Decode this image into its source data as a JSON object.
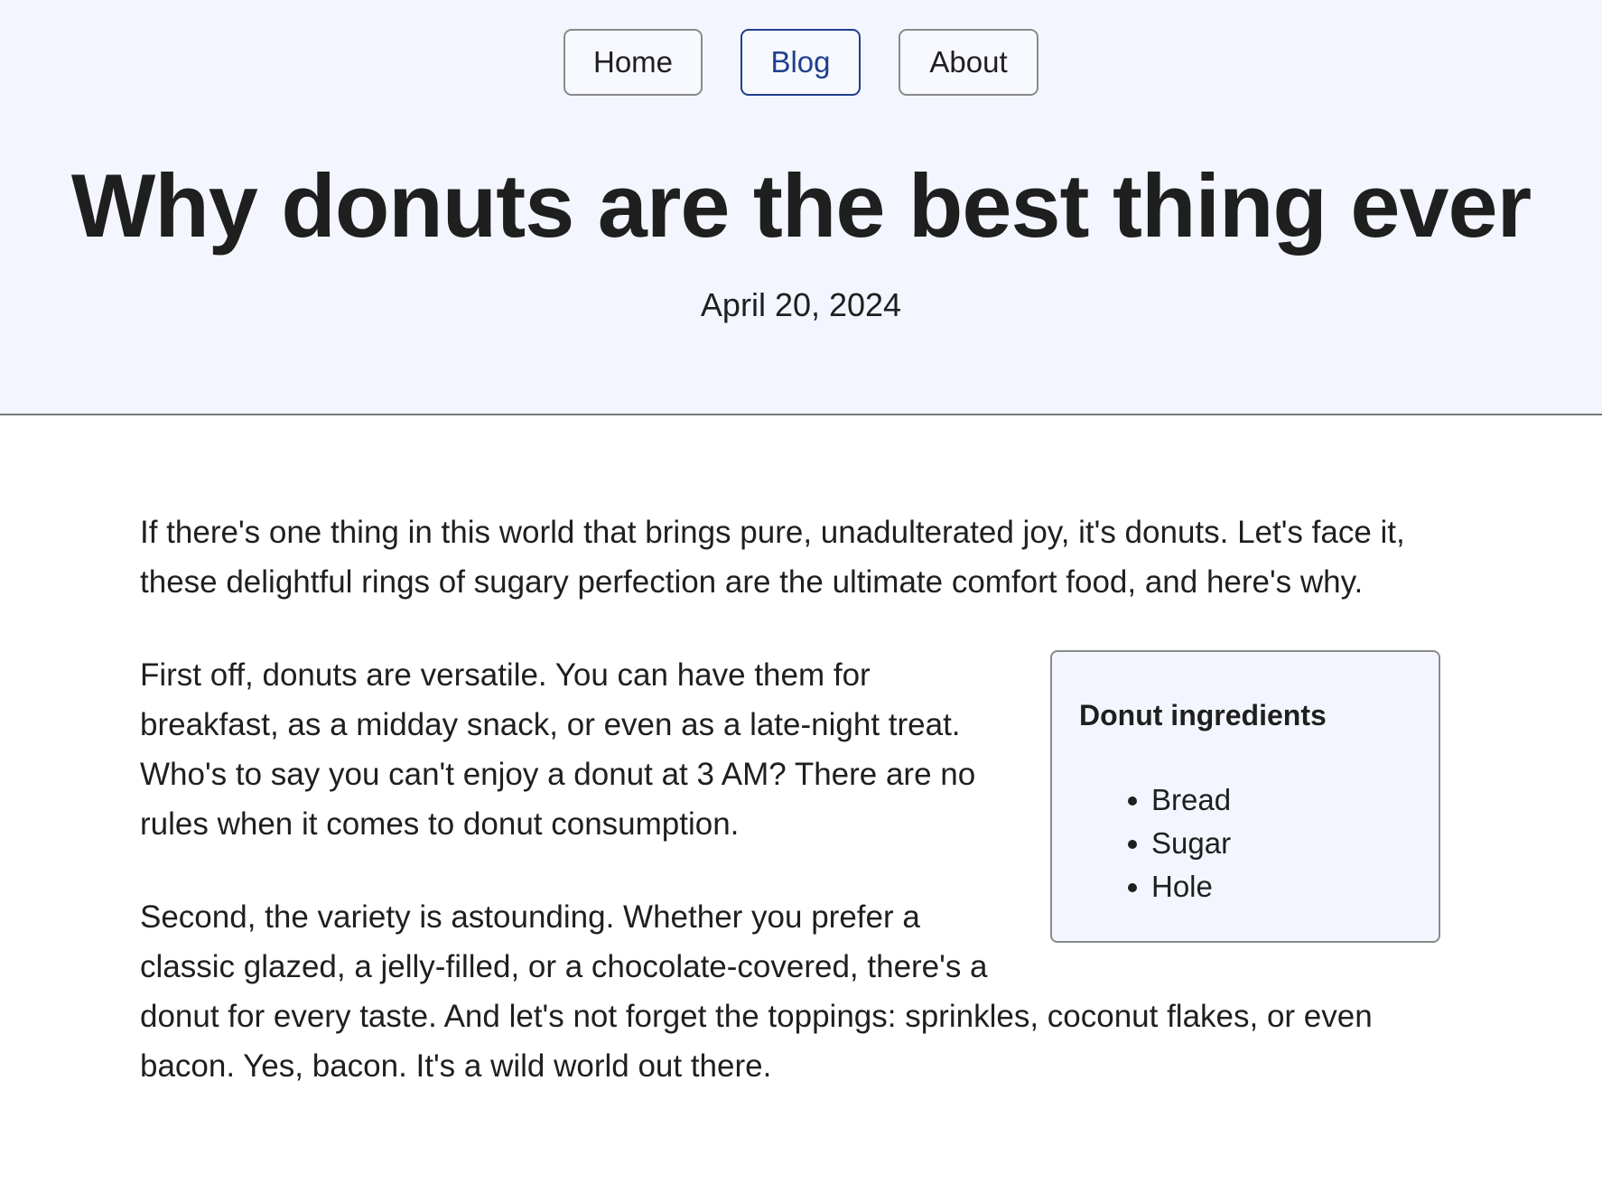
{
  "nav": {
    "items": [
      {
        "label": "Home"
      },
      {
        "label": "Blog"
      },
      {
        "label": "About"
      }
    ]
  },
  "header": {
    "title": "Why donuts are the best thing ever",
    "date": "April 20, 2024"
  },
  "article": {
    "paragraphs": [
      "If there's one thing in this world that brings pure, unadulterated joy, it's donuts. Let's face it, these delightful rings of sugary perfection are the ultimate comfort food, and here's why.",
      "First off, donuts are versatile. You can have them for breakfast, as a midday snack, or even as a late-night treat. Who's to say you can't enjoy a donut at 3 AM? There are no rules when it comes to donut consumption.",
      "Second, the variety is astounding. Whether you prefer a classic glazed, a jelly-filled, or a chocolate-covered, there's a donut for every taste. And let's not forget the toppings: sprinkles, coconut flakes, or even bacon. Yes, bacon. It's a wild world out there."
    ],
    "sidebar": {
      "title": "Donut ingredients",
      "items": [
        "Bread",
        "Sugar",
        "Hole"
      ]
    }
  }
}
